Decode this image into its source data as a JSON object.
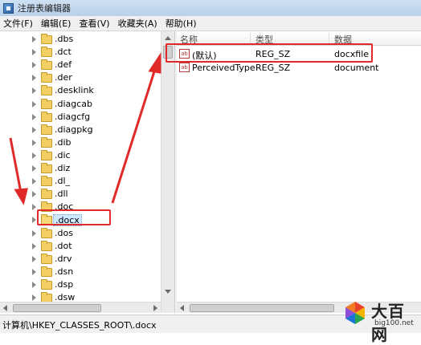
{
  "window": {
    "title": "注册表编辑器"
  },
  "menu": [
    "文件(F)",
    "编辑(E)",
    "查看(V)",
    "收藏夹(A)",
    "帮助(H)"
  ],
  "tree": {
    "items": [
      ".dbs",
      ".dct",
      ".def",
      ".der",
      ".desklink",
      ".diagcab",
      ".diagcfg",
      ".diagpkg",
      ".dib",
      ".dic",
      ".diz",
      ".dl_",
      ".dll",
      ".doc",
      ".docx",
      ".dos",
      ".dot",
      ".drv",
      ".dsn",
      ".dsp",
      ".dsw"
    ],
    "selected": ".docx"
  },
  "list": {
    "columns": [
      "名称",
      "类型",
      "数据"
    ],
    "rows": [
      {
        "icon": "ab",
        "name": "(默认)",
        "type": "REG_SZ",
        "data": "docxfile"
      },
      {
        "icon": "ab",
        "name": "PerceivedType",
        "type": "REG_SZ",
        "data": "document"
      }
    ]
  },
  "status": {
    "path": "计算机\\HKEY_CLASSES_ROOT\\.docx"
  },
  "watermark": {
    "title": "大百网",
    "subtitle": "big100.net"
  },
  "colors": {
    "annotation": "#e02a2a",
    "selection": "#cde8ff",
    "folder": "#f3cf63"
  }
}
